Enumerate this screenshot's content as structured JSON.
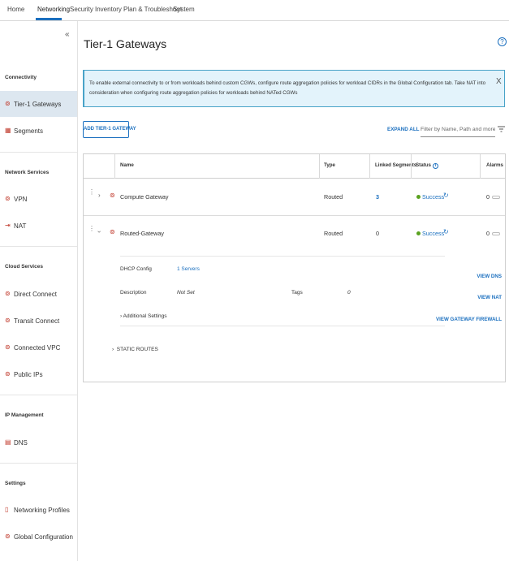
{
  "topnav": {
    "tabs": [
      "Home",
      "Networking",
      "Security",
      "Inventory",
      "Plan & Troubleshoot",
      "System"
    ]
  },
  "sidebar": {
    "collapse_glyph": "«",
    "sections": [
      {
        "title": "Connectivity",
        "items": [
          "Tier-1 Gateways",
          "Segments"
        ]
      },
      {
        "title": "Network Services",
        "items": [
          "VPN",
          "NAT"
        ]
      },
      {
        "title": "Cloud Services",
        "items": [
          "Direct Connect",
          "Transit Connect",
          "Connected VPC",
          "Public IPs"
        ]
      },
      {
        "title": "IP Management",
        "items": [
          "DNS"
        ]
      },
      {
        "title": "Settings",
        "items": [
          "Networking Profiles",
          "Global Configuration"
        ]
      }
    ]
  },
  "main": {
    "title": "Tier-1 Gateways",
    "help_glyph": "?",
    "banner": {
      "text": "To enable external connectivity to or from workloads behind custom CGWs, configure route aggregation policies for workload CIDRs in the Global Configuration tab. Take NAT into consideration when configuring route aggregation policies for workloads behind NATed CGWs",
      "close": "X"
    },
    "add_button": "ADD TIER-1 GATEWAY",
    "expand_all": "EXPAND ALL",
    "filter_placeholder": "Filter by Name, Path and more",
    "columns": {
      "name": "Name",
      "type": "Type",
      "linked": "Linked Segments",
      "status": "Status",
      "alarms": "Alarms"
    },
    "rows": [
      {
        "name": "Compute Gateway",
        "type": "Routed",
        "linked": "3",
        "status": "Success",
        "alarms": "0"
      },
      {
        "name": "Routed-Gateway",
        "type": "Routed",
        "linked": "0",
        "status": "Success",
        "alarms": "0"
      }
    ],
    "detail": {
      "dhcp_label": "DHCP Config",
      "dhcp_value": "1 Servers",
      "desc_label": "Description",
      "desc_value": "Not Set",
      "tags_label": "Tags",
      "tags_value": "0",
      "additional": "Additional Settings",
      "static_routes": "STATIC ROUTES",
      "view_dns": "VIEW DNS",
      "view_nat": "VIEW NAT",
      "view_fw": "VIEW GATEWAY FIREWALL"
    },
    "colors": {
      "accent": "#1a6fbf",
      "success": "#5aa220",
      "banner_bg": "#e3f3fb",
      "icon_red": "#c0392b"
    }
  }
}
